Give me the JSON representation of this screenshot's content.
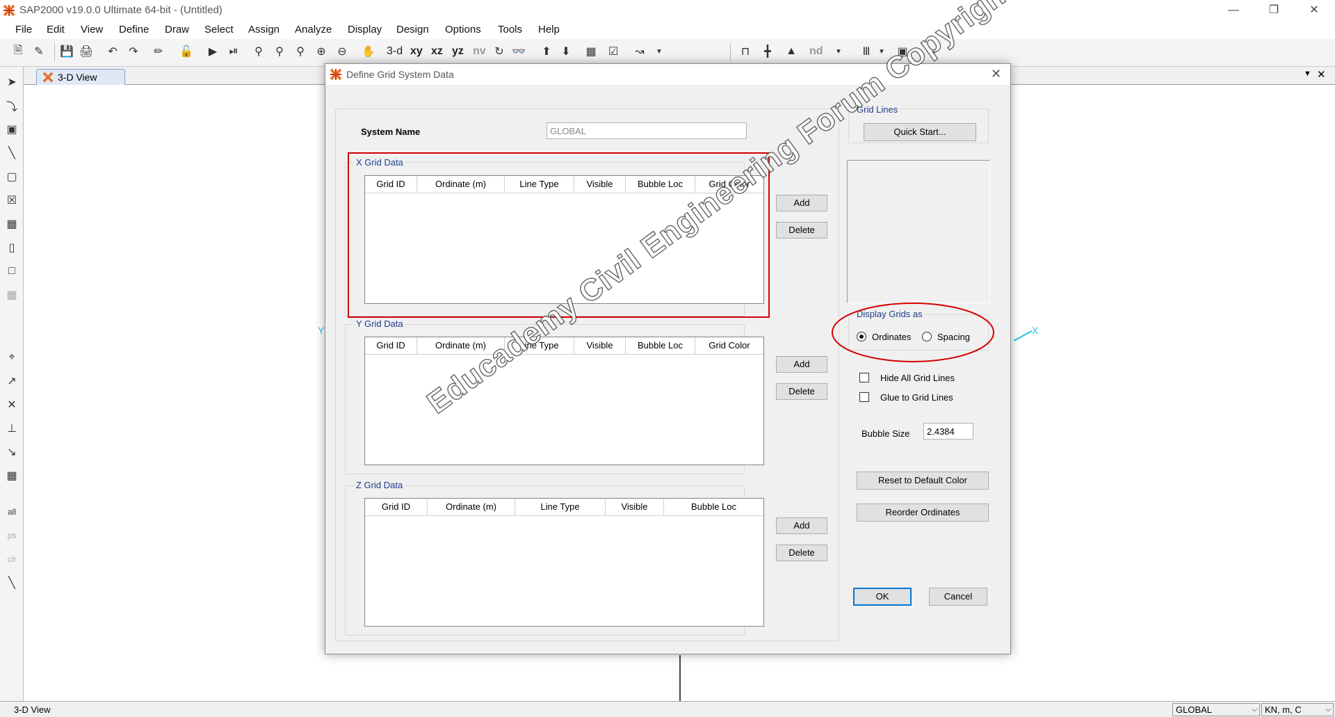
{
  "app": {
    "title": "SAP2000 v19.0.0 Ultimate 64-bit - (Untitled)"
  },
  "menu": [
    "File",
    "Edit",
    "View",
    "Define",
    "Draw",
    "Select",
    "Assign",
    "Analyze",
    "Display",
    "Design",
    "Options",
    "Tools",
    "Help"
  ],
  "toolbar_text": {
    "t3d": "3-d",
    "xy": "xy",
    "xz": "xz",
    "yz": "yz",
    "nv": "nv",
    "nd": "nd"
  },
  "view_tab": {
    "label": "3-D View"
  },
  "view_axes": {
    "y": "Y",
    "x": "X"
  },
  "status": {
    "left": "3-D View",
    "coord": "GLOBAL",
    "units": "KN, m, C"
  },
  "dialog": {
    "title": "Define Grid System Data",
    "system_name_label": "System Name",
    "system_name_value": "GLOBAL",
    "x_grid": {
      "title": "X Grid Data",
      "columns": [
        "Grid ID",
        "Ordinate (m)",
        "Line Type",
        "Visible",
        "Bubble Loc",
        "Grid Color"
      ],
      "add": "Add",
      "delete": "Delete"
    },
    "y_grid": {
      "title": "Y Grid Data",
      "columns": [
        "Grid ID",
        "Ordinate (m)",
        "Line Type",
        "Visible",
        "Bubble Loc",
        "Grid Color"
      ],
      "add": "Add",
      "delete": "Delete"
    },
    "z_grid": {
      "title": "Z Grid Data",
      "columns": [
        "Grid ID",
        "Ordinate (m)",
        "Line Type",
        "Visible",
        "Bubble Loc"
      ],
      "add": "Add",
      "delete": "Delete"
    },
    "grid_lines": {
      "title": "Grid Lines",
      "quick_start": "Quick Start..."
    },
    "display_grids": {
      "title": "Display Grids as",
      "ordinates": "Ordinates",
      "spacing": "Spacing",
      "selected": "Ordinates"
    },
    "hide_all_grid_lines": "Hide All Grid Lines",
    "glue_to_grid_lines": "Glue to Grid Lines",
    "bubble_size_label": "Bubble Size",
    "bubble_size_value": "2.4384",
    "reset_color": "Reset to Default Color",
    "reorder": "Reorder Ordinates",
    "ok": "OK",
    "cancel": "Cancel"
  },
  "watermark": "Educademy Civil Engineering Forum Copyright",
  "colors": {
    "annotation": "#d40000",
    "group_label": "#1d3b8b",
    "axis": "#19c8e0"
  }
}
